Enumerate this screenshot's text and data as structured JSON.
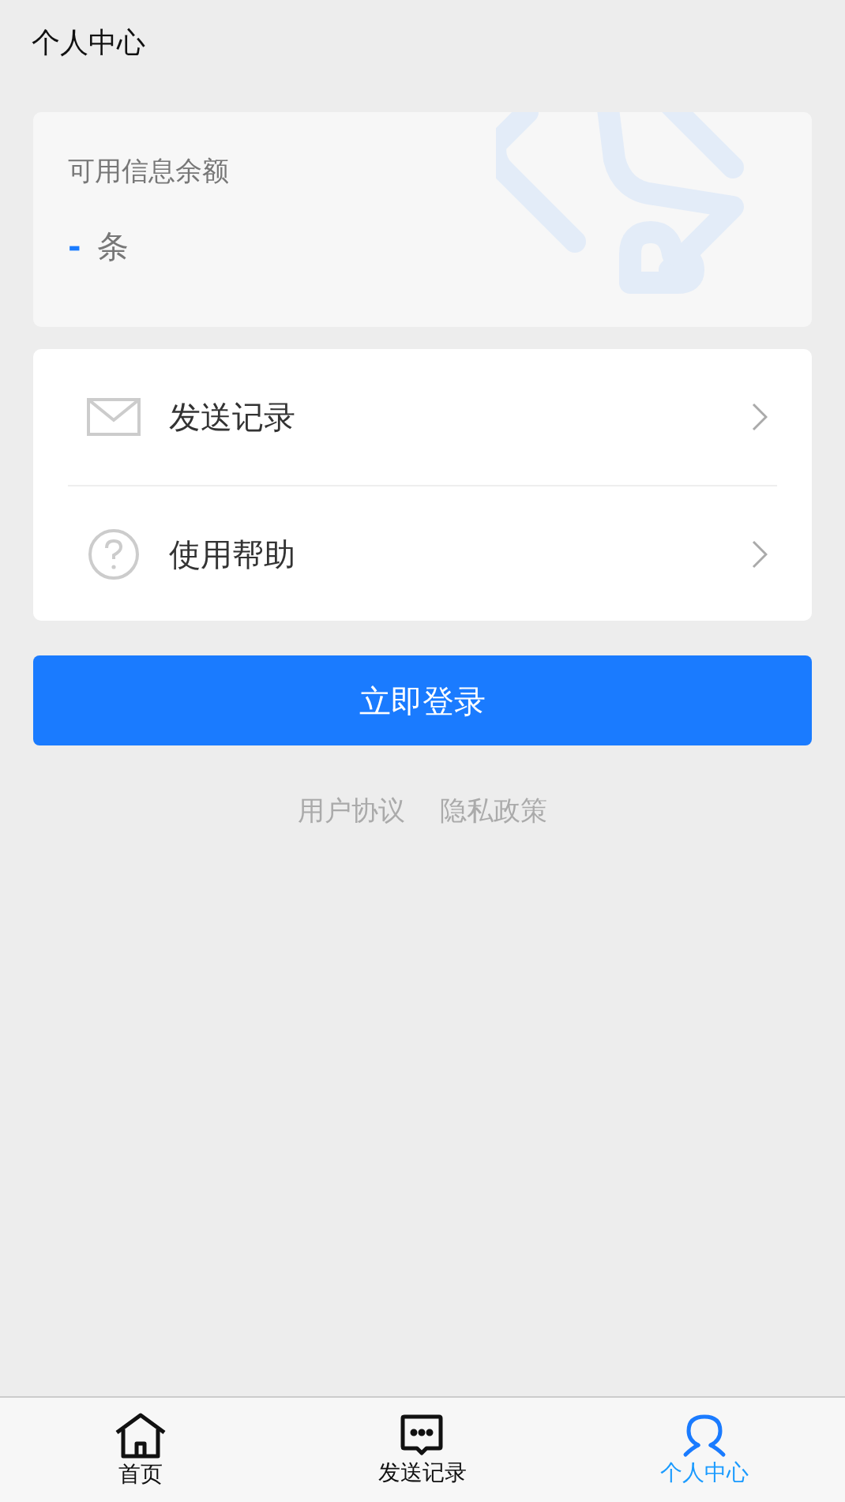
{
  "header": {
    "title": "个人中心"
  },
  "balance": {
    "label": "可用信息余额",
    "value": "-",
    "unit": "条"
  },
  "menu": [
    {
      "kind": "envelope",
      "label": "发送记录"
    },
    {
      "kind": "help",
      "label": "使用帮助"
    }
  ],
  "login_button": "立即登录",
  "links": [
    "用户协议",
    "隐私政策"
  ],
  "tabbar": [
    {
      "kind": "home",
      "label": "首页",
      "selected": false
    },
    {
      "kind": "chat",
      "label": "发送记录",
      "selected": false
    },
    {
      "kind": "user",
      "label": "个人中心",
      "selected": true
    }
  ]
}
